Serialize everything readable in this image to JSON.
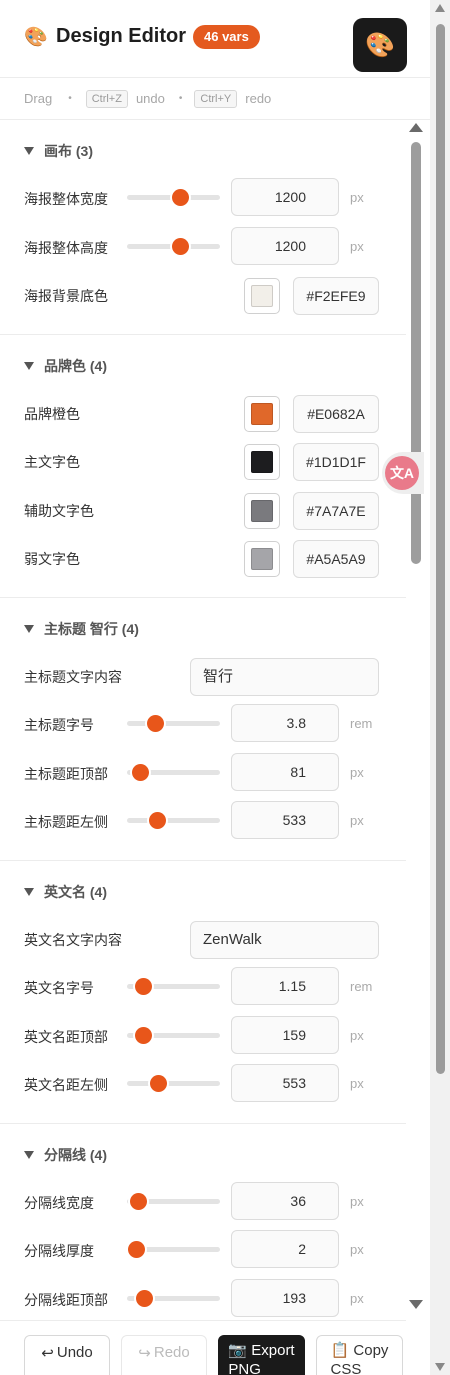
{
  "header": {
    "title": "Design Editor",
    "badge": "46 vars",
    "icon": "palette-icon"
  },
  "shortcuts": {
    "drag": "Drag",
    "undo_key": "Ctrl+Z",
    "undo_word": "undo",
    "redo_key": "Ctrl+Y",
    "redo_word": "redo"
  },
  "colors": {
    "accent": "#E8561A",
    "badge": "#E45A1F",
    "dark_button": "#1A1A1A"
  },
  "sections": [
    {
      "title": "画布 (3)",
      "rows": [
        {
          "type": "slider",
          "label": "海报整体宽度",
          "value": "1200",
          "unit": "px",
          "fill": 0.57
        },
        {
          "type": "slider",
          "label": "海报整体高度",
          "value": "1200",
          "unit": "px",
          "fill": 0.57
        },
        {
          "type": "color",
          "label": "海报背景底色",
          "hex": "#F2EFE9"
        }
      ]
    },
    {
      "title": "品牌色 (4)",
      "rows": [
        {
          "type": "color",
          "label": "品牌橙色",
          "hex": "#E0682A"
        },
        {
          "type": "color",
          "label": "主文字色",
          "hex": "#1D1D1F"
        },
        {
          "type": "color",
          "label": "辅助文字色",
          "hex": "#7A7A7E"
        },
        {
          "type": "color",
          "label": "弱文字色",
          "hex": "#A5A5A9"
        }
      ]
    },
    {
      "title": "主标题 智行 (4)",
      "rows": [
        {
          "type": "text",
          "label": "主标题文字内容",
          "value": "智行"
        },
        {
          "type": "slider",
          "label": "主标题字号",
          "value": "3.8",
          "unit": "rem",
          "fill": 0.3
        },
        {
          "type": "slider",
          "label": "主标题距顶部",
          "value": "81",
          "unit": "px",
          "fill": 0.14
        },
        {
          "type": "slider",
          "label": "主标题距左侧",
          "value": "533",
          "unit": "px",
          "fill": 0.32
        }
      ]
    },
    {
      "title": "英文名 (4)",
      "rows": [
        {
          "type": "text",
          "label": "英文名文字内容",
          "value": "ZenWalk"
        },
        {
          "type": "slider",
          "label": "英文名字号",
          "value": "1.15",
          "unit": "rem",
          "fill": 0.17
        },
        {
          "type": "slider",
          "label": "英文名距顶部",
          "value": "159",
          "unit": "px",
          "fill": 0.17
        },
        {
          "type": "slider",
          "label": "英文名距左侧",
          "value": "553",
          "unit": "px",
          "fill": 0.33
        }
      ]
    },
    {
      "title": "分隔线 (4)",
      "rows": [
        {
          "type": "slider",
          "label": "分隔线宽度",
          "value": "36",
          "unit": "px",
          "fill": 0.12
        },
        {
          "type": "slider",
          "label": "分隔线厚度",
          "value": "2",
          "unit": "px",
          "fill": 0.1
        },
        {
          "type": "slider",
          "label": "分隔线距顶部",
          "value": "193",
          "unit": "px",
          "fill": 0.18
        }
      ]
    }
  ],
  "footer": {
    "undo": "Undo",
    "redo": "Redo",
    "export": "Export PNG",
    "copy": "Copy CSS"
  }
}
